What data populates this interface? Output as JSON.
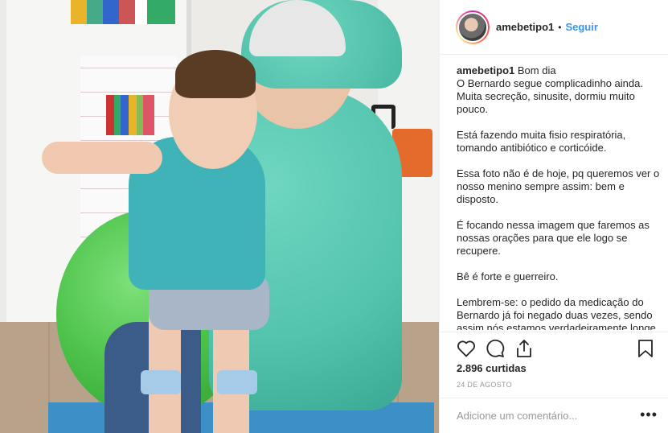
{
  "header": {
    "username": "amebetipo1",
    "separator": "•",
    "follow_label": "Seguir"
  },
  "caption": {
    "username": "amebetipo1",
    "first_line": "Bom dia",
    "paragraphs": [
      "O Bernardo segue complicadinho ainda. Muita secreção, sinusite, dormiu muito pouco.",
      "Está fazendo muita fisio respiratória, tomando antibiótico e corticóide.",
      "Essa foto não é de hoje, pq queremos ver o nosso menino sempre assim: bem e disposto.",
      "É focando nessa imagem que faremos as nossas orações para que ele logo se recupere.",
      "Bê é forte e guerreiro.",
      "Lembrem-se: o pedido da medicação do Bernardo já foi negado duas vezes, sendo assim nós estamos verdadeiramente longe"
    ]
  },
  "actions": {
    "icons": [
      "heart-icon",
      "comment-icon",
      "share-icon",
      "bookmark-icon"
    ]
  },
  "likes": "2.896 curtidas",
  "date": "24 DE AGOSTO",
  "comment": {
    "placeholder": "Adicione um comentário...",
    "more_label": "•••"
  }
}
